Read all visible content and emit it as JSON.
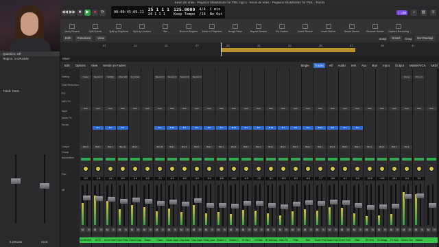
{
  "window": {
    "title": "Kevin de Vries - Pegasus Mix&Master for PML.logicx - Kevin de Vries - Pegasus Mix&Master for PML - Tracks"
  },
  "transport": {
    "time": "00:00:45:09.11",
    "bars": "25  1  1  1",
    "bars2": "24  1  1  1",
    "tempo": "125.0000",
    "tempo_label": "Keep Tempo",
    "sig": "4/4",
    "div": "/16",
    "key": "C min",
    "in": "No In",
    "out": "No Out",
    "badge": "♩=34"
  },
  "toolbar": [
    "Verify Repeat",
    "Split Events",
    "Split by Playhead",
    "Split by Locators",
    "Join",
    "Bounce Regions",
    "Move to Playhead",
    "Nudge Value",
    "Repeat Section",
    "Cut Section",
    "Insert Silence",
    "Insert Marker",
    "Delete Marker",
    "Rename Marker",
    "Capture Recording"
  ],
  "arrange": {
    "edit": "Edit",
    "functions": "Functions",
    "view": "View",
    "snap": "Snap:",
    "snap_value": "Smart",
    "drag": "Drag:",
    "drag_value": "No Overlap",
    "section": "Arrangement",
    "ruler_marks": [
      "21",
      "23",
      "25",
      "27",
      "29",
      "31",
      "33",
      "35",
      "37",
      "39",
      "41"
    ]
  },
  "mixer": {
    "head": "Mixer",
    "menu": [
      "Edit",
      "Options",
      "View",
      "Sends on Faders"
    ],
    "filters": [
      "Single",
      "Tracks",
      "All",
      "Audio",
      "Inst",
      "Aux",
      "Bus",
      "Input",
      "Output",
      "Master/VCA",
      "MIDI"
    ],
    "active_filter": "Tracks",
    "row_labels": [
      "Setting",
      "Gain Reduction",
      "EQ",
      "MIDI FX",
      "Input",
      "Audio FX",
      "Sends",
      "Output",
      "Group",
      "Automation",
      "Pan",
      "dB"
    ],
    "strips": [
      {
        "name": "S-DRUMS",
        "color": "#35c64a",
        "peak": "-0.9",
        "vol": 0.7,
        "lvl": 0.55,
        "plugin": "Sugar",
        "send": "",
        "bus": "Bus 4"
      },
      {
        "name": "KICK",
        "color": "#35c64a",
        "peak": "-2.8",
        "vol": 0.68,
        "lvl": 0.75,
        "plugin": "Neutron 3",
        "send": "B 2",
        "bus": "Bus 1"
      },
      {
        "name": "KICK FIBER",
        "color": "#35c64a",
        "peak": "-4.1",
        "vol": 0.66,
        "lvl": 0.6,
        "plugin": "SplitEQ",
        "send": "B 6",
        "bus": "Bus 1"
      },
      {
        "name": "Kick Filter",
        "color": "#35c64a",
        "peak": "-6.0",
        "vol": 0.6,
        "lvl": 0.4,
        "plugin": "Chan EQ",
        "send": "B 6",
        "bus": "Bus 31"
      },
      {
        "name": "Grand Clap",
        "color": "#35c64a",
        "peak": "-3.6",
        "vol": 0.64,
        "lvl": 0.5,
        "plugin": "bx_limiter",
        "send": "",
        "bus": "Bus 1"
      },
      {
        "name": "Snare",
        "color": "#35c64a",
        "peak": "-5.2",
        "vol": 0.6,
        "lvl": 0.45,
        "plugin": "",
        "send": "",
        "bus": ""
      },
      {
        "name": "Clean",
        "color": "#35c64a",
        "peak": "-7.1",
        "vol": 0.55,
        "lvl": 0.35,
        "plugin": "Neutron 3",
        "send": "B 2",
        "bus": "Bus 22"
      },
      {
        "name": "Clean Layer",
        "color": "#35c64a",
        "peak": "-6.3",
        "vol": 0.58,
        "lvl": 0.42,
        "plugin": "Neutron 3",
        "send": "B 13",
        "bus": "Bus 1"
      },
      {
        "name": "Clap Inter",
        "color": "#35c64a",
        "peak": "-8.0",
        "vol": 0.52,
        "lvl": 0.33,
        "plugin": "Neutron 3",
        "send": "B 2",
        "bus": "Bus 1"
      },
      {
        "name": "Clap Layer",
        "color": "#35c64a",
        "peak": "-4.9",
        "vol": 0.62,
        "lvl": 0.5,
        "plugin": "Neutron 3",
        "send": "B 2",
        "bus": "Bus 1"
      },
      {
        "name": "Shak_pour",
        "color": "#35c64a",
        "peak": "-9.4",
        "vol": 0.5,
        "lvl": 0.3,
        "plugin": "",
        "send": "B 6",
        "bus": "Bus 1"
      },
      {
        "name": "Shaker 1",
        "color": "#35c64a",
        "peak": "-8.8",
        "vol": 0.5,
        "lvl": 0.32,
        "plugin": "",
        "send": "B 2",
        "bus": "Bus 1"
      },
      {
        "name": "Shaker 2",
        "color": "#35c64a",
        "peak": "-10.2",
        "vol": 0.47,
        "lvl": 0.28,
        "plugin": "",
        "send": "B 13",
        "bus": "Bus 1"
      },
      {
        "name": "Hi Hat 1",
        "color": "#35c64a",
        "peak": "-6.9",
        "vol": 0.55,
        "lvl": 0.38,
        "plugin": "",
        "send": "B 2",
        "bus": "Bus 1"
      },
      {
        "name": "Hi Hats",
        "color": "#35c64a",
        "peak": "-7.5",
        "vol": 0.54,
        "lvl": 0.36,
        "plugin": "",
        "send": "B 6",
        "bus": "Bus 1"
      },
      {
        "name": "Hi Hats long",
        "color": "#35c64a",
        "peak": "-9.1",
        "vol": 0.5,
        "lvl": 0.3,
        "plugin": "",
        "send": "B 13",
        "bus": "Bus 1"
      },
      {
        "name": "Hats Fill",
        "color": "#35c64a",
        "peak": "-11.0",
        "vol": 0.46,
        "lvl": 0.25,
        "plugin": "",
        "send": "B 2",
        "bus": "Bus 1"
      },
      {
        "name": "Ride",
        "color": "#35c64a",
        "peak": "-8.3",
        "vol": 0.52,
        "lvl": 0.34,
        "plugin": "",
        "send": "B 6",
        "bus": "Bus 1"
      },
      {
        "name": "Bell",
        "color": "#35c64a",
        "peak": "-6.6",
        "vol": 0.56,
        "lvl": 0.4,
        "plugin": "",
        "send": "B 2",
        "bus": "Bus 1"
      },
      {
        "name": "Snare Roll",
        "color": "#35c64a",
        "peak": "-7.7",
        "vol": 0.54,
        "lvl": 0.37,
        "plugin": "",
        "send": "B 13",
        "bus": "Bus 1"
      },
      {
        "name": "Snare Roll 2",
        "color": "#35c64a",
        "peak": "-5.8",
        "vol": 0.58,
        "lvl": 0.44,
        "plugin": "",
        "send": "B 6",
        "bus": "Bus 1"
      },
      {
        "name": "Snare Roll 3",
        "color": "#35c64a",
        "peak": "-6.1",
        "vol": 0.57,
        "lvl": 0.43,
        "plugin": "",
        "send": "B 2",
        "bus": "Bus 1"
      },
      {
        "name": "Rise",
        "color": "#35c64a",
        "peak": "-9.0",
        "vol": 0.5,
        "lvl": 0.3,
        "plugin": "",
        "send": "B 2",
        "bus": "Bus 1"
      },
      {
        "name": "Sh Verb",
        "color": "#35c64a",
        "peak": "-12.3",
        "vol": 0.44,
        "lvl": 0.22,
        "plugin": "",
        "send": "",
        "bus": "Bus 1"
      },
      {
        "name": "Sh Mstgs",
        "color": "#35c64a",
        "peak": "-11.6",
        "vol": 0.45,
        "lvl": 0.24,
        "plugin": "",
        "send": "",
        "bus": "Bus 1"
      },
      {
        "name": "Fx Kick",
        "color": "#35c64a",
        "peak": "-10.1",
        "vol": 0.48,
        "lvl": 0.28,
        "plugin": "",
        "send": "",
        "bus": "Bus 1"
      },
      {
        "name": "Stereo Out",
        "color": "#35c64a",
        "peak": "-0.4",
        "vol": 0.72,
        "lvl": 0.82,
        "plugin": "Ozone",
        "send": "",
        "bus": "Out 1"
      },
      {
        "name": "Master",
        "color": "#35c64a",
        "peak": "0.0",
        "vol": 0.74,
        "lvl": 0.78,
        "plugin": "Pro-L 2",
        "send": "",
        "bus": ""
      },
      {
        "name": "",
        "color": "#35c64a",
        "peak": "",
        "vol": 0.5,
        "lvl": 0,
        "plugin": "",
        "send": "",
        "bus": ""
      }
    ]
  },
  "inspector": {
    "quantize": "Quantize",
    "quantize_val": "Off",
    "region": "Region: S-DRUMS",
    "track": "Track: KICK",
    "strip_left": "S-DRUMS",
    "strip_right": "KICK"
  }
}
